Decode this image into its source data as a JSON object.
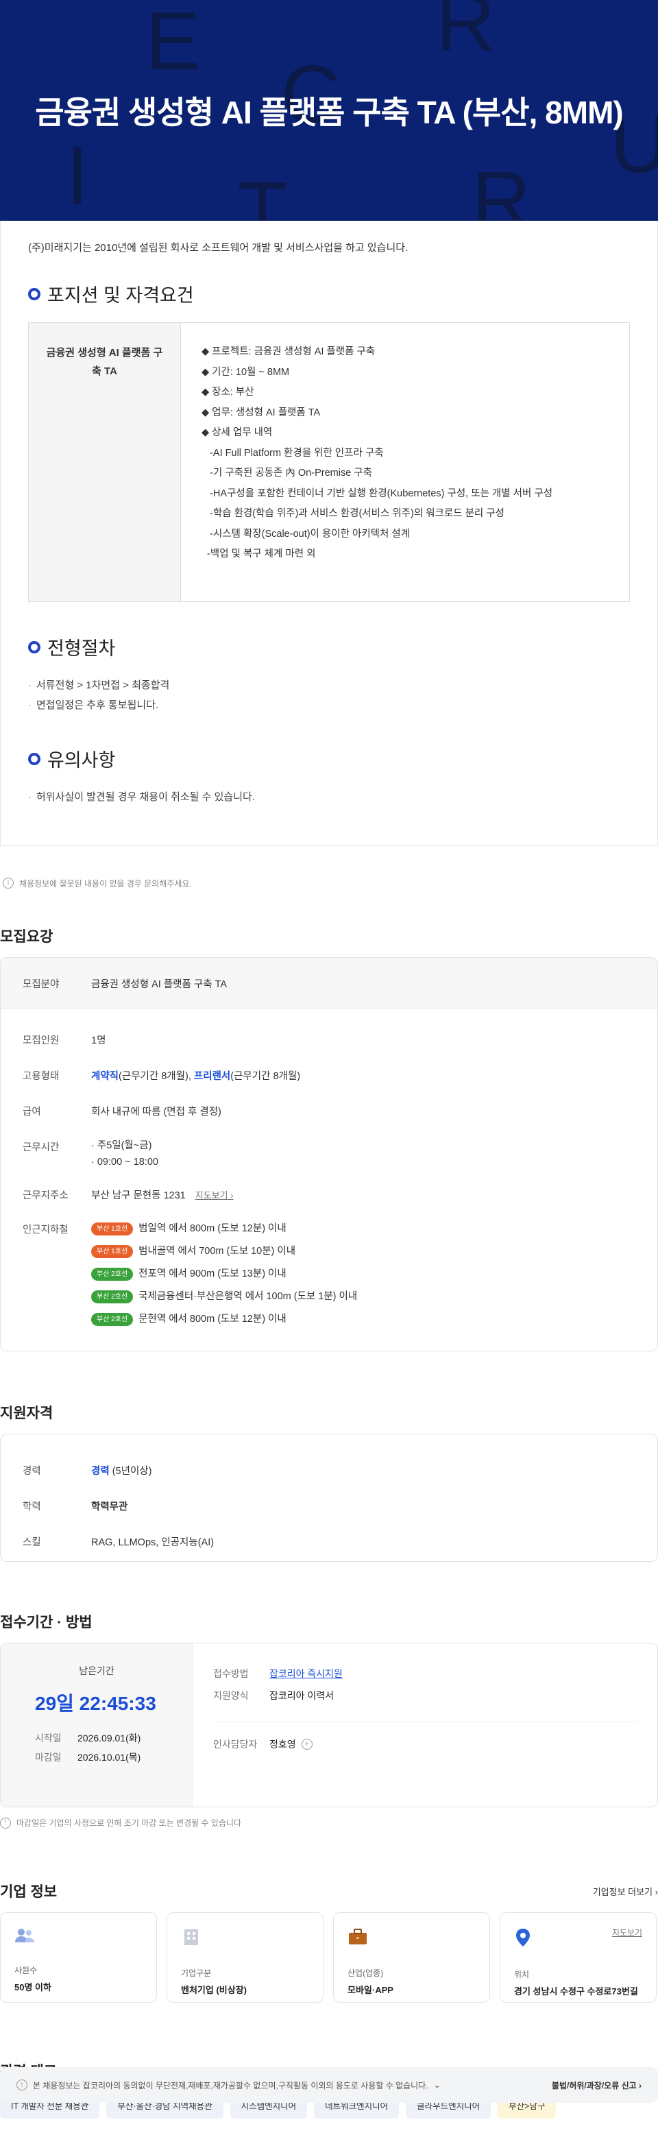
{
  "hero": {
    "title": "금융권 생성형 AI 플랫폼 구축 TA (부산, 8MM)",
    "ghost_letters": [
      "E",
      "C",
      "R",
      "I",
      "T",
      "R",
      "U"
    ]
  },
  "detail": {
    "intro": "(주)미래지기는 2010년에 설립된 회사로 소프트웨어 개발 및 서비스사업을 하고 있습니다.",
    "position_title": "포지션 및 자격요건",
    "position_name": "금융권 생성형 AI 플랫폼 구축 TA",
    "position_lines": [
      "◆ 프로젝트: 금융권 생성형 AI 플랫폼 구축",
      "◆ 기간: 10월 ~ 8MM",
      "◆ 장소: 부산",
      "◆ 업무: 생성형 AI 플랫폼 TA",
      "◆ 상세 업무 내역",
      "   -AI Full Platform 환경을 위한 인프라 구축",
      "   -기 구축된 공동존 內 On-Premise 구축",
      "   -HA구성을 포함한 컨테이너 기반 실행 환경(Kubernetes) 구성, 또는 개별 서버 구성",
      "   -학습 환경(학습 위주)과 서비스 환경(서비스 위주)의 워크로드 분리 구성",
      "   -시스템 확장(Scale-out)이 용이한 아키텍처 설계",
      "  -백업 및 복구 체계 마련 외"
    ],
    "process_title": "전형절차",
    "process_items": [
      "서류전형 > 1차면접 > 최종합격",
      "면접일정은 추후 통보됩니다."
    ],
    "notice_title": "유의사항",
    "notice_items": [
      "허위사실이 발견될 경우 채용이 취소될 수 있습니다."
    ]
  },
  "report_text": "채용정보에 잘못된 내용이 있을 경우 문의해주세요.",
  "recruit": {
    "title": "모집요강",
    "field_label": "모집분야",
    "field_value": "금융권 생성형 AI 플랫폼 구축 TA",
    "count_label": "모집인원",
    "count_value": "1명",
    "type_label": "고용형태",
    "type_a": "계약직",
    "type_a_note": "(근무기간 8개월),",
    "type_b": "프리랜서",
    "type_b_note": "(근무기간 8개월)",
    "salary_label": "급여",
    "salary_value": "회사 내규에 따름 (면접 후 결정)",
    "hours_label": "근무시간",
    "hours_items": [
      "주5일(월~금)",
      "09:00 ~ 18:00"
    ],
    "address_label": "근무지주소",
    "address_value": "부산 남구 문현동 1231",
    "map_link": "지도보기",
    "nearby_label": "인근지하철",
    "stations": [
      {
        "line": "부산 1호선",
        "color": "#e8612c",
        "text": "범일역 에서 800m (도보 12분) 이내"
      },
      {
        "line": "부산 1호선",
        "color": "#e8612c",
        "text": "범내골역 에서 700m (도보 10분) 이내"
      },
      {
        "line": "부산 2호선",
        "color": "#3aa23a",
        "text": "전포역 에서 900m (도보 13분) 이내"
      },
      {
        "line": "부산 2호선",
        "color": "#3aa23a",
        "text": "국제금융센터·부산은행역 에서 100m (도보 1분) 이내"
      },
      {
        "line": "부산 2호선",
        "color": "#3aa23a",
        "text": "문현역 에서 800m (도보 12분) 이내"
      }
    ]
  },
  "qual": {
    "title": "지원자격",
    "exp_label": "경력",
    "exp_value": "경력",
    "exp_note": "(5년이상)",
    "edu_label": "학력",
    "edu_value": "학력무관",
    "skill_label": "스킬",
    "skill_value": "RAG, LLMOps, 인공지능(AI)"
  },
  "apply": {
    "title": "접수기간 · 방법",
    "remain_label": "남은기간",
    "remain_value": "29일 22:45:33",
    "start_label": "시작일",
    "start_value": "2026.09.01(화)",
    "end_label": "마감일",
    "end_value": "2026.10.01(목)",
    "method_label": "접수방법",
    "method_value": "잡코리아 즉시지원",
    "form_label": "지원양식",
    "form_value": "잡코리아 이력서",
    "hr_label": "인사담당자",
    "hr_value": "정호영",
    "note": "마감일은 기업의 사정으로 인해 조기 마감 또는 변경될 수 있습니다"
  },
  "company": {
    "title": "기업 정보",
    "more": "기업정보 더보기",
    "cards": [
      {
        "label": "사원수",
        "value": "50명 이하",
        "icon": "people-icon"
      },
      {
        "label": "기업구분",
        "value": "벤처기업 (비상장)",
        "icon": "building-icon"
      },
      {
        "label": "산업(업종)",
        "value": "모바일·APP",
        "icon": "briefcase-icon"
      },
      {
        "label": "위치",
        "value": "경기 성남시 수정구 수정로73번길",
        "icon": "map-pin-icon",
        "link": "지도보기"
      }
    ]
  },
  "tags": {
    "title": "관련 태그",
    "items": [
      "IT 개발자 전문 채용관",
      "부산·울산·경남 지역채용관",
      "시스템엔지니어",
      "네트워크엔지니어",
      "클라우드엔지니어",
      "부산>남구"
    ]
  },
  "footer": {
    "copyright": "본 채용정보는 잡코리아의 동의없이 무단전재,재배포,재가공할수 없으며,구직활동 이외의 용도로 사용할 수 없습니다.",
    "report": "불법/허위/과장/오류 신고"
  },
  "colors": {
    "hero_bg": "#0a2271",
    "accent": "#1a4ed8",
    "ring": "#2144c4"
  }
}
